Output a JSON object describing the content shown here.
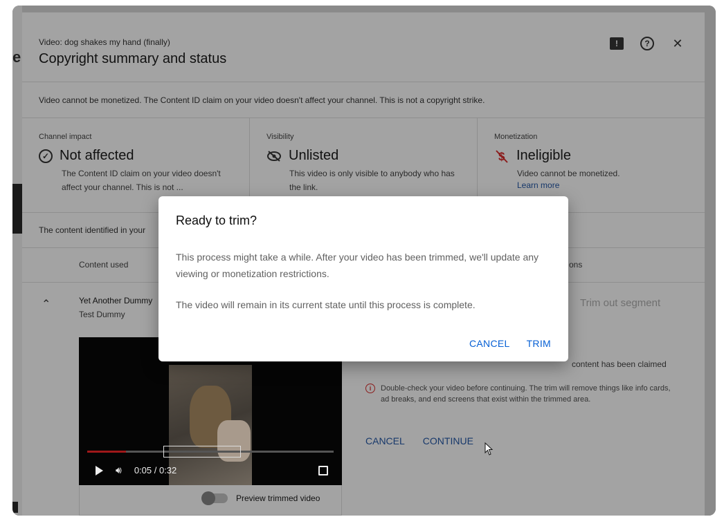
{
  "background": {
    "left_text": "e",
    "video_label": "Video: dog shakes my hand (finally)",
    "title": "Copyright summary and status",
    "notice": "Video cannot be monetized. The Content ID claim on your video doesn't affect your channel. This is not a copyright strike.",
    "columns": [
      {
        "label": "Channel impact",
        "status": "Not affected",
        "icon": "check-circle-icon",
        "desc": "The Content ID claim on your video doesn't affect your channel. This is not ..."
      },
      {
        "label": "Visibility",
        "status": "Unlisted",
        "icon": "eye-off-icon",
        "desc": "This video is only visible to anybody who has the link."
      },
      {
        "label": "Monetization",
        "status": "Ineligible",
        "icon": "no-money-icon",
        "desc": "Video cannot be monetized.",
        "link": "Learn more"
      }
    ],
    "content_line": "The content identified in your",
    "table_header": "Content used",
    "actions_header": "ons",
    "row_title": "Yet Another Dummy",
    "row_sub": "Test Dummy",
    "trim_segment": "Trim out segment",
    "claimed_text": "content has been claimed",
    "warning": "Double-check your video before continuing. The trim will remove things like info cards, ad breaks, and end screens that exist within the trimmed area.",
    "cancel": "CANCEL",
    "continue": "CONTINUE",
    "player_time": "0:05 / 0:32",
    "player_progress": 0.156,
    "preview_label": "Preview trimmed video"
  },
  "dialog": {
    "title": "Ready to trim?",
    "body_1": "This process might take a while. After your video has been trimmed, we'll update any viewing or monetization restrictions.",
    "body_2": "The video will remain in its current state until this process is complete.",
    "cancel": "CANCEL",
    "trim": "TRIM"
  },
  "colors": {
    "accent": "#065fd4",
    "overlay": "#a3a3a3"
  }
}
